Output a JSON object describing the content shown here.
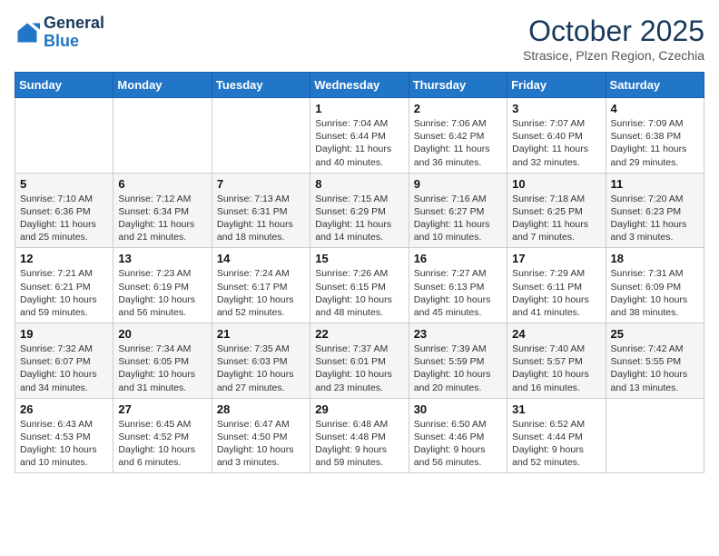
{
  "header": {
    "logo_line1": "General",
    "logo_line2": "Blue",
    "title": "October 2025",
    "subtitle": "Strasice, Plzen Region, Czechia"
  },
  "days_of_week": [
    "Sunday",
    "Monday",
    "Tuesday",
    "Wednesday",
    "Thursday",
    "Friday",
    "Saturday"
  ],
  "weeks": [
    [
      {
        "day": "",
        "info": ""
      },
      {
        "day": "",
        "info": ""
      },
      {
        "day": "",
        "info": ""
      },
      {
        "day": "1",
        "info": "Sunrise: 7:04 AM\nSunset: 6:44 PM\nDaylight: 11 hours and 40 minutes."
      },
      {
        "day": "2",
        "info": "Sunrise: 7:06 AM\nSunset: 6:42 PM\nDaylight: 11 hours and 36 minutes."
      },
      {
        "day": "3",
        "info": "Sunrise: 7:07 AM\nSunset: 6:40 PM\nDaylight: 11 hours and 32 minutes."
      },
      {
        "day": "4",
        "info": "Sunrise: 7:09 AM\nSunset: 6:38 PM\nDaylight: 11 hours and 29 minutes."
      }
    ],
    [
      {
        "day": "5",
        "info": "Sunrise: 7:10 AM\nSunset: 6:36 PM\nDaylight: 11 hours and 25 minutes."
      },
      {
        "day": "6",
        "info": "Sunrise: 7:12 AM\nSunset: 6:34 PM\nDaylight: 11 hours and 21 minutes."
      },
      {
        "day": "7",
        "info": "Sunrise: 7:13 AM\nSunset: 6:31 PM\nDaylight: 11 hours and 18 minutes."
      },
      {
        "day": "8",
        "info": "Sunrise: 7:15 AM\nSunset: 6:29 PM\nDaylight: 11 hours and 14 minutes."
      },
      {
        "day": "9",
        "info": "Sunrise: 7:16 AM\nSunset: 6:27 PM\nDaylight: 11 hours and 10 minutes."
      },
      {
        "day": "10",
        "info": "Sunrise: 7:18 AM\nSunset: 6:25 PM\nDaylight: 11 hours and 7 minutes."
      },
      {
        "day": "11",
        "info": "Sunrise: 7:20 AM\nSunset: 6:23 PM\nDaylight: 11 hours and 3 minutes."
      }
    ],
    [
      {
        "day": "12",
        "info": "Sunrise: 7:21 AM\nSunset: 6:21 PM\nDaylight: 10 hours and 59 minutes."
      },
      {
        "day": "13",
        "info": "Sunrise: 7:23 AM\nSunset: 6:19 PM\nDaylight: 10 hours and 56 minutes."
      },
      {
        "day": "14",
        "info": "Sunrise: 7:24 AM\nSunset: 6:17 PM\nDaylight: 10 hours and 52 minutes."
      },
      {
        "day": "15",
        "info": "Sunrise: 7:26 AM\nSunset: 6:15 PM\nDaylight: 10 hours and 48 minutes."
      },
      {
        "day": "16",
        "info": "Sunrise: 7:27 AM\nSunset: 6:13 PM\nDaylight: 10 hours and 45 minutes."
      },
      {
        "day": "17",
        "info": "Sunrise: 7:29 AM\nSunset: 6:11 PM\nDaylight: 10 hours and 41 minutes."
      },
      {
        "day": "18",
        "info": "Sunrise: 7:31 AM\nSunset: 6:09 PM\nDaylight: 10 hours and 38 minutes."
      }
    ],
    [
      {
        "day": "19",
        "info": "Sunrise: 7:32 AM\nSunset: 6:07 PM\nDaylight: 10 hours and 34 minutes."
      },
      {
        "day": "20",
        "info": "Sunrise: 7:34 AM\nSunset: 6:05 PM\nDaylight: 10 hours and 31 minutes."
      },
      {
        "day": "21",
        "info": "Sunrise: 7:35 AM\nSunset: 6:03 PM\nDaylight: 10 hours and 27 minutes."
      },
      {
        "day": "22",
        "info": "Sunrise: 7:37 AM\nSunset: 6:01 PM\nDaylight: 10 hours and 23 minutes."
      },
      {
        "day": "23",
        "info": "Sunrise: 7:39 AM\nSunset: 5:59 PM\nDaylight: 10 hours and 20 minutes."
      },
      {
        "day": "24",
        "info": "Sunrise: 7:40 AM\nSunset: 5:57 PM\nDaylight: 10 hours and 16 minutes."
      },
      {
        "day": "25",
        "info": "Sunrise: 7:42 AM\nSunset: 5:55 PM\nDaylight: 10 hours and 13 minutes."
      }
    ],
    [
      {
        "day": "26",
        "info": "Sunrise: 6:43 AM\nSunset: 4:53 PM\nDaylight: 10 hours and 10 minutes."
      },
      {
        "day": "27",
        "info": "Sunrise: 6:45 AM\nSunset: 4:52 PM\nDaylight: 10 hours and 6 minutes."
      },
      {
        "day": "28",
        "info": "Sunrise: 6:47 AM\nSunset: 4:50 PM\nDaylight: 10 hours and 3 minutes."
      },
      {
        "day": "29",
        "info": "Sunrise: 6:48 AM\nSunset: 4:48 PM\nDaylight: 9 hours and 59 minutes."
      },
      {
        "day": "30",
        "info": "Sunrise: 6:50 AM\nSunset: 4:46 PM\nDaylight: 9 hours and 56 minutes."
      },
      {
        "day": "31",
        "info": "Sunrise: 6:52 AM\nSunset: 4:44 PM\nDaylight: 9 hours and 52 minutes."
      },
      {
        "day": "",
        "info": ""
      }
    ]
  ]
}
